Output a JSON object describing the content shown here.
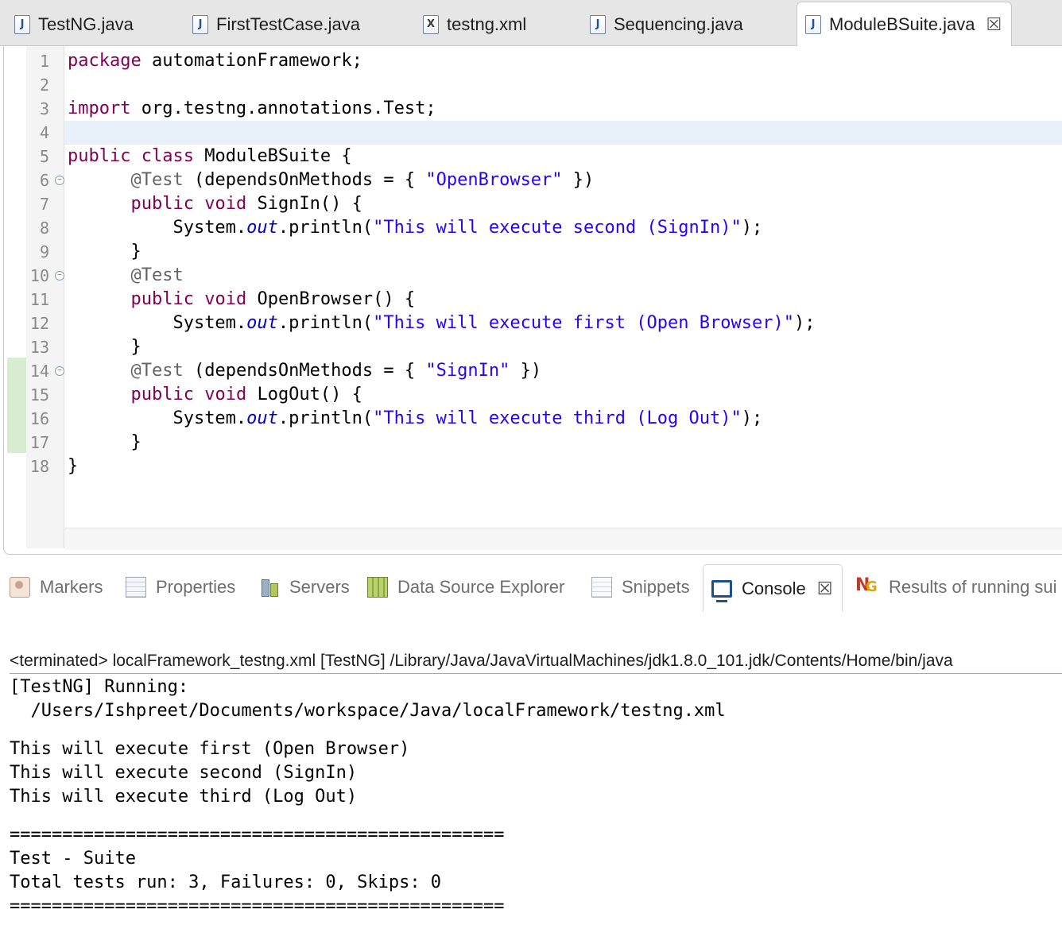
{
  "editor_tabs": [
    {
      "label": "TestNG.java",
      "icon": "java-file-icon",
      "glyph": "J"
    },
    {
      "label": "FirstTestCase.java",
      "icon": "java-file-icon",
      "glyph": "J"
    },
    {
      "label": "testng.xml",
      "icon": "xml-file-icon",
      "glyph": "X"
    },
    {
      "label": "Sequencing.java",
      "icon": "java-file-icon",
      "glyph": "J"
    },
    {
      "label": "ModuleBSuite.java",
      "icon": "java-file-icon",
      "glyph": "J",
      "active": true
    }
  ],
  "close_glyph": "☒",
  "fold_glyph": "−",
  "editor": {
    "line_numbers": [
      "1",
      "2",
      "3",
      "4",
      "5",
      "6",
      "7",
      "8",
      "9",
      "10",
      "11",
      "12",
      "13",
      "14",
      "15",
      "16",
      "17",
      "18"
    ],
    "code": {
      "l1": {
        "kw": "package",
        "rest": " automationFramework;"
      },
      "l3": {
        "kw": "import",
        "rest": " org.testng.annotations.Test;"
      },
      "l5": {
        "kw1": "public",
        "kw2": "class",
        "rest": " ModuleBSuite {"
      },
      "l6": {
        "indent": "      ",
        "ann": "@Test",
        "mid": " (dependsOnMethods = { ",
        "str": "\"OpenBrowser\"",
        "end": " })"
      },
      "l7": {
        "indent": "      ",
        "kw1": "public",
        "kw2": "void",
        "rest": " SignIn() {"
      },
      "l8": {
        "indent": "          ",
        "pre": "System.",
        "fld": "out",
        "mid": ".println(",
        "str": "\"This will execute second (SignIn)\"",
        "end": ");"
      },
      "l9": {
        "text": "      }"
      },
      "l10": {
        "indent": "      ",
        "ann": "@Test"
      },
      "l11": {
        "indent": "      ",
        "kw1": "public",
        "kw2": "void",
        "rest": " OpenBrowser() {"
      },
      "l12": {
        "indent": "          ",
        "pre": "System.",
        "fld": "out",
        "mid": ".println(",
        "str": "\"This will execute first (Open Browser)\"",
        "end": ");"
      },
      "l13": {
        "text": "      }"
      },
      "l14": {
        "indent": "      ",
        "ann": "@Test",
        "mid": " (dependsOnMethods = { ",
        "str": "\"SignIn\"",
        "end": " })"
      },
      "l15": {
        "indent": "      ",
        "kw1": "public",
        "kw2": "void",
        "rest": " LogOut() {"
      },
      "l16": {
        "indent": "          ",
        "pre": "System.",
        "fld": "out",
        "mid": ".println(",
        "str": "\"This will execute third (Log Out)\"",
        "end": ");"
      },
      "l17": {
        "text": "      }"
      },
      "l18": {
        "text": "}"
      }
    }
  },
  "view_tabs": [
    {
      "label": "Markers",
      "icon": "markers-icon"
    },
    {
      "label": "Properties",
      "icon": "properties-icon"
    },
    {
      "label": "Servers",
      "icon": "servers-icon"
    },
    {
      "label": "Data Source Explorer",
      "icon": "data-source-explorer-icon"
    },
    {
      "label": "Snippets",
      "icon": "snippets-icon"
    },
    {
      "label": "Console",
      "icon": "console-icon",
      "active": true
    },
    {
      "label": "Results of running sui",
      "icon": "testng-results-icon"
    }
  ],
  "console": {
    "header": "<terminated> localFramework_testng.xml [TestNG] /Library/Java/JavaVirtualMachines/jdk1.8.0_101.jdk/Contents/Home/bin/java",
    "lines": [
      "[TestNG] Running:",
      "  /Users/Ishpreet/Documents/workspace/Java/localFramework/testng.xml",
      "This will execute first (Open Browser)",
      "This will execute second (SignIn)",
      "This will execute third (Log Out)",
      "===============================================",
      "Test - Suite",
      "Total tests run: 3, Failures: 0, Skips: 0",
      "==============================================="
    ]
  }
}
